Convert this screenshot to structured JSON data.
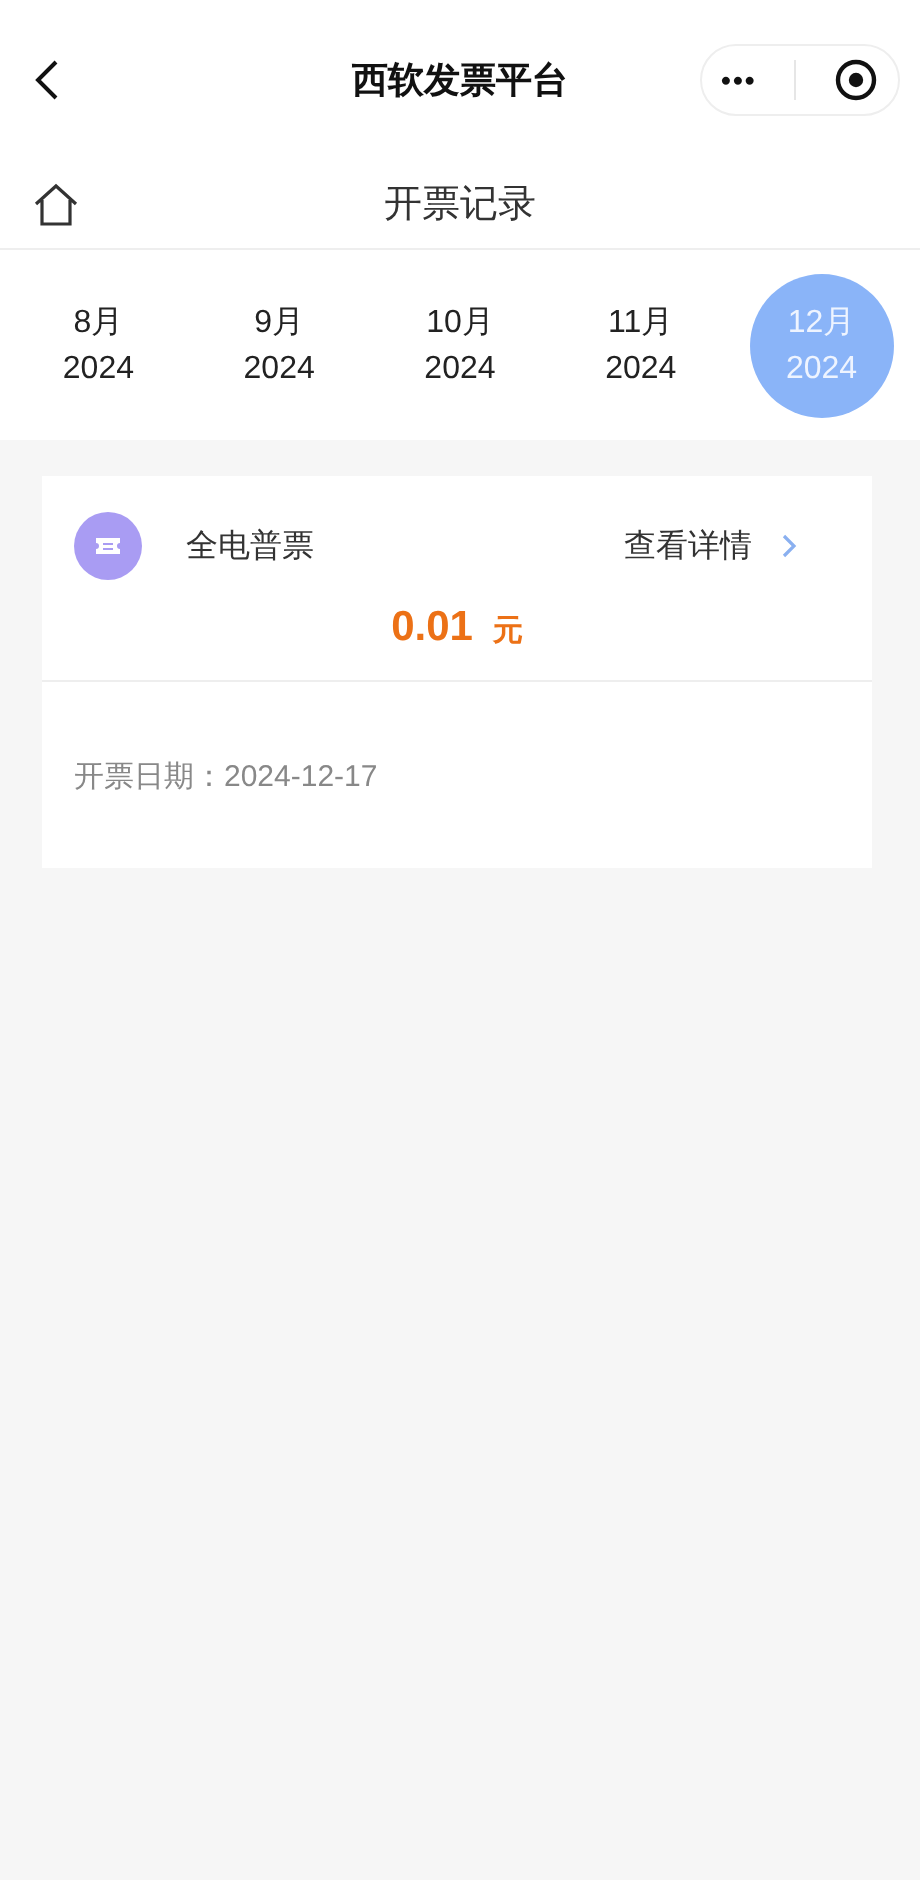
{
  "nav_bar": {
    "title": "西软发票平台",
    "more": "•••"
  },
  "header": {
    "title": "开票记录"
  },
  "months": [
    {
      "month": "8月",
      "year": "2024",
      "selected": false
    },
    {
      "month": "9月",
      "year": "2024",
      "selected": false
    },
    {
      "month": "10月",
      "year": "2024",
      "selected": false
    },
    {
      "month": "11月",
      "year": "2024",
      "selected": false
    },
    {
      "month": "12月",
      "year": "2024",
      "selected": true
    }
  ],
  "invoices": [
    {
      "type": "全电普票",
      "link": "查看详情",
      "amount": "0.01",
      "unit": "元",
      "date": "开票日期：2024-12-17"
    }
  ]
}
